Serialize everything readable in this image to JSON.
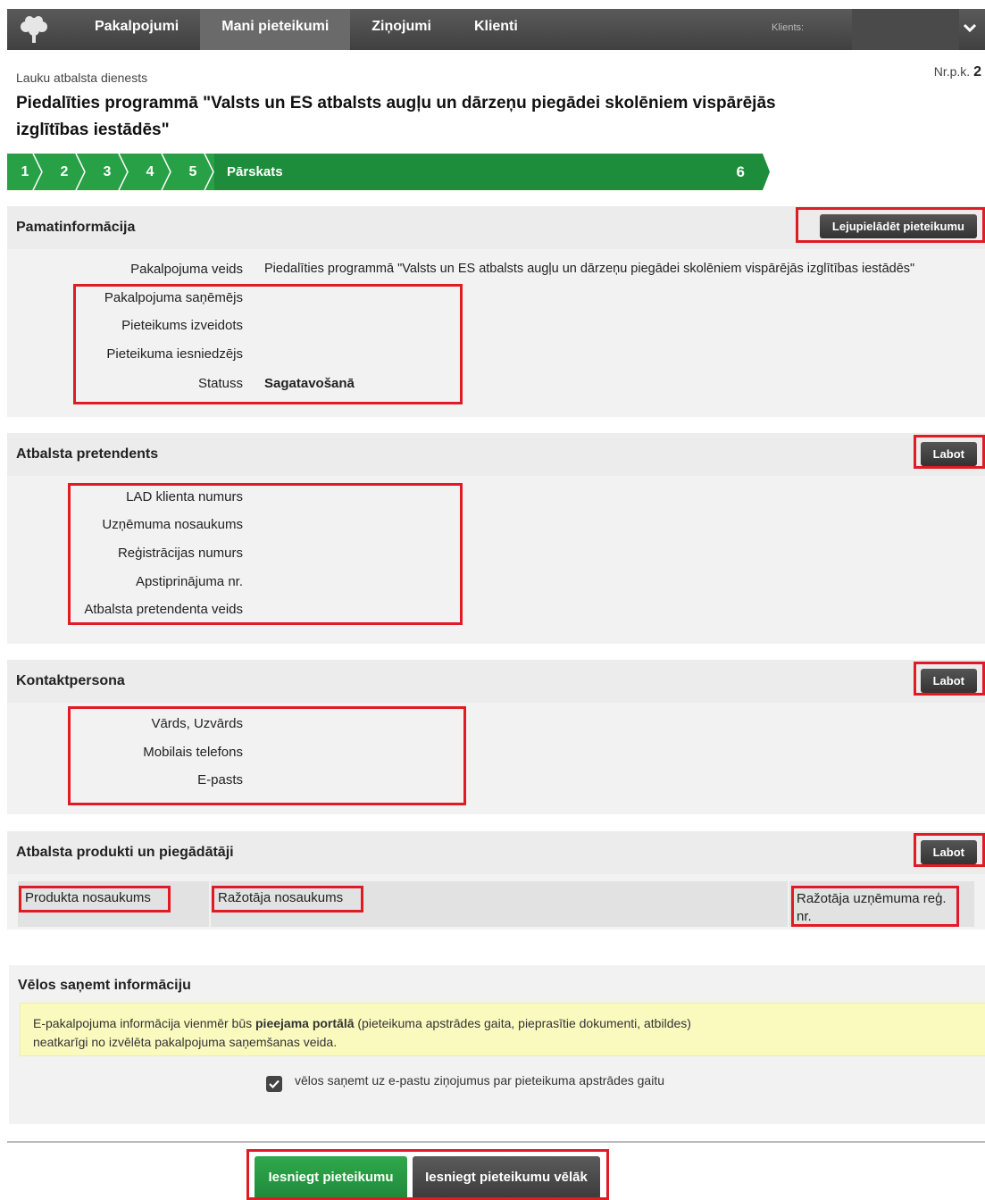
{
  "nav": {
    "items": [
      {
        "label": "Pakalpojumi",
        "active": false
      },
      {
        "label": "Mani pieteikumi",
        "active": true
      },
      {
        "label": "Ziņojumi",
        "active": false
      },
      {
        "label": "Klienti",
        "active": false
      }
    ],
    "clients_label": "Klients:",
    "logo_icon": "oak-tree-logo",
    "menu_icon": "chevron-down-icon"
  },
  "header": {
    "agency": "Lauku atbalsta dienests",
    "nrpk_label": "Nr.p.k.",
    "nrpk_value": "2",
    "title": "Piedalīties programmā \"Valsts un ES atbalsts augļu un dārzeņu piegādei skolēniem vispārējās izglītības iestādēs\""
  },
  "steps": {
    "numbers": [
      "1",
      "2",
      "3",
      "4",
      "5"
    ],
    "current_label": "Pārskats",
    "current_number": "6",
    "color": "#27a046"
  },
  "pamatinformacija": {
    "title": "Pamatinformācija",
    "download_button": "Lejupielādēt pieteikumu",
    "rows": [
      {
        "label": "Pakalpojuma veids",
        "value": "Piedalīties programmā \"Valsts un ES atbalsts augļu un dārzeņu piegādei skolēniem vispārējās izglītības iestādēs\""
      },
      {
        "label": "Pakalpojuma saņēmējs",
        "value": ""
      },
      {
        "label": "Pieteikums izveidots",
        "value": ""
      },
      {
        "label": "Pieteikuma iesniedzējs",
        "value": ""
      },
      {
        "label": "Statuss",
        "value": "Sagatavošanā"
      }
    ]
  },
  "pretendents": {
    "title": "Atbalsta pretendents",
    "edit_button": "Labot",
    "rows": [
      {
        "label": "LAD klienta numurs"
      },
      {
        "label": "Uzņēmuma nosaukums"
      },
      {
        "label": "Reģistrācijas numurs"
      },
      {
        "label": "Apstiprinājuma nr."
      },
      {
        "label": "Atbalsta pretendenta veids"
      }
    ]
  },
  "kontaktpersona": {
    "title": "Kontaktpersona",
    "edit_button": "Labot",
    "rows": [
      {
        "label": "Vārds, Uzvārds"
      },
      {
        "label": "Mobilais telefons"
      },
      {
        "label": "E-pasts"
      }
    ]
  },
  "produkti": {
    "title": "Atbalsta produkti un piegādātāji",
    "edit_button": "Labot",
    "columns": [
      "Produkta nosaukums",
      "Ražotāja nosaukums",
      "Ražotāja uzņēmuma reģ. nr."
    ]
  },
  "info": {
    "title": "Vēlos saņemt informāciju",
    "note_part1": "E-pakalpojuma informācija vienmēr būs ",
    "note_bold": "pieejama portālā",
    "note_part2": " (pieteikuma apstrādes gaita, pieprasītie dokumenti, atbildes)",
    "note_line2": "neatkarīgi no izvēlēta pakalpojuma saņemšanas veida.",
    "checkbox_label": "vēlos saņemt uz e-pastu ziņojumus par pieteikuma apstrādes gaitu",
    "checkbox_checked": true
  },
  "actions": {
    "submit": "Iesniegt pieteikumu",
    "submit_later": "Iesniegt pieteikumu vēlāk"
  },
  "colors": {
    "nav_bg": "#404040",
    "green": "#27a046",
    "highlight": "#e01b24",
    "note_bg": "#fafabf"
  }
}
